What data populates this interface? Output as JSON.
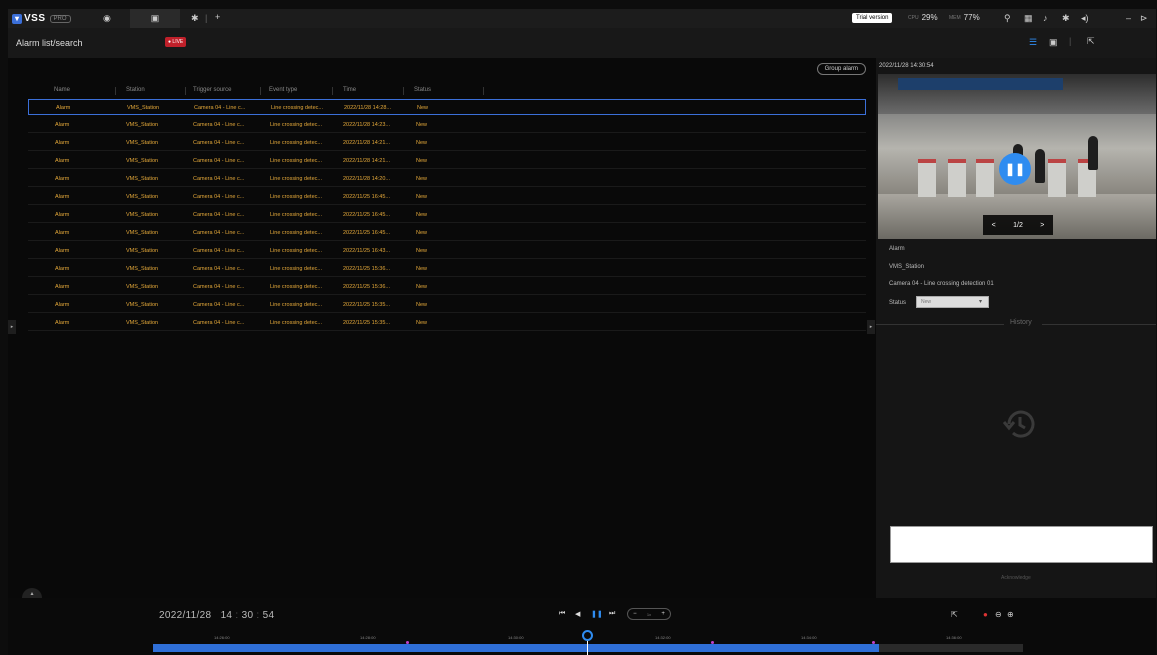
{
  "topbar": {
    "logo_text": "VSS",
    "logo_badge": "PRO",
    "trial_label": "Trial version",
    "cpu_label": "CPU",
    "cpu_value": "29%",
    "mem_label": "MEM",
    "mem_value": "77%"
  },
  "subheader": {
    "title": "Alarm list/search",
    "live_badge": "LIVE"
  },
  "main": {
    "group_alarm": "Group alarm",
    "columns": [
      "Name",
      "Station",
      "Trigger source",
      "Event type",
      "Time",
      "Status"
    ],
    "rows": [
      [
        "Alarm",
        "VMS_Station",
        "Camera 04 - Line c...",
        "Line crossing detec...",
        "2022/11/28 14:28...",
        "New"
      ],
      [
        "Alarm",
        "VMS_Station",
        "Camera 04 - Line c...",
        "Line crossing detec...",
        "2022/11/28 14:23...",
        "New"
      ],
      [
        "Alarm",
        "VMS_Station",
        "Camera 04 - Line c...",
        "Line crossing detec...",
        "2022/11/28 14:21...",
        "New"
      ],
      [
        "Alarm",
        "VMS_Station",
        "Camera 04 - Line c...",
        "Line crossing detec...",
        "2022/11/28 14:21...",
        "New"
      ],
      [
        "Alarm",
        "VMS_Station",
        "Camera 04 - Line c...",
        "Line crossing detec...",
        "2022/11/28 14:20...",
        "New"
      ],
      [
        "Alarm",
        "VMS_Station",
        "Camera 04 - Line c...",
        "Line crossing detec...",
        "2022/11/25 16:45...",
        "New"
      ],
      [
        "Alarm",
        "VMS_Station",
        "Camera 04 - Line c...",
        "Line crossing detec...",
        "2022/11/25 16:45...",
        "New"
      ],
      [
        "Alarm",
        "VMS_Station",
        "Camera 04 - Line c...",
        "Line crossing detec...",
        "2022/11/25 16:45...",
        "New"
      ],
      [
        "Alarm",
        "VMS_Station",
        "Camera 04 - Line c...",
        "Line crossing detec...",
        "2022/11/25 16:43...",
        "New"
      ],
      [
        "Alarm",
        "VMS_Station",
        "Camera 04 - Line c...",
        "Line crossing detec...",
        "2022/11/25 15:36...",
        "New"
      ],
      [
        "Alarm",
        "VMS_Station",
        "Camera 04 - Line c...",
        "Line crossing detec...",
        "2022/11/25 15:36...",
        "New"
      ],
      [
        "Alarm",
        "VMS_Station",
        "Camera 04 - Line c...",
        "Line crossing detec...",
        "2022/11/25 15:35...",
        "New"
      ],
      [
        "Alarm",
        "VMS_Station",
        "Camera 04 - Line c...",
        "Line crossing detec...",
        "2022/11/25 15:35...",
        "New"
      ]
    ]
  },
  "detail": {
    "timestamp": "2022/11/28 14:30:54",
    "pager_prev": "<",
    "pager_text": "1/2",
    "pager_next": ">",
    "name": "Alarm",
    "station": "VMS_Station",
    "source": "Camera 04 - Line crossing detection 01",
    "status_label": "Status",
    "status_value": "New",
    "history_title": "History",
    "acknowledge": "Acknowledge"
  },
  "playback": {
    "date": "2022/11/28",
    "hour": "14",
    "minute": "30",
    "second": "54",
    "speed_minus": "−",
    "speed_value": "1x",
    "speed_plus": "+",
    "timeline_labels": [
      "14:26:00",
      "14:28:00",
      "14:30:00",
      "14:32:00",
      "14:34:00",
      "14:36:00"
    ]
  },
  "colors": {
    "accent": "#2f8cf0",
    "row_text": "#e5a93a",
    "live": "#c0202a",
    "event_marker": "#c041c9"
  },
  "icons": [
    "vss-logo-icon",
    "eye-icon",
    "playback-icon",
    "settings-icon",
    "add-tab-icon",
    "search-icon",
    "grid-icon",
    "bell-icon",
    "gear-icon",
    "volume-icon",
    "minimize-icon",
    "list-view-icon",
    "thumbnail-view-icon",
    "export-icon",
    "history-icon"
  ]
}
